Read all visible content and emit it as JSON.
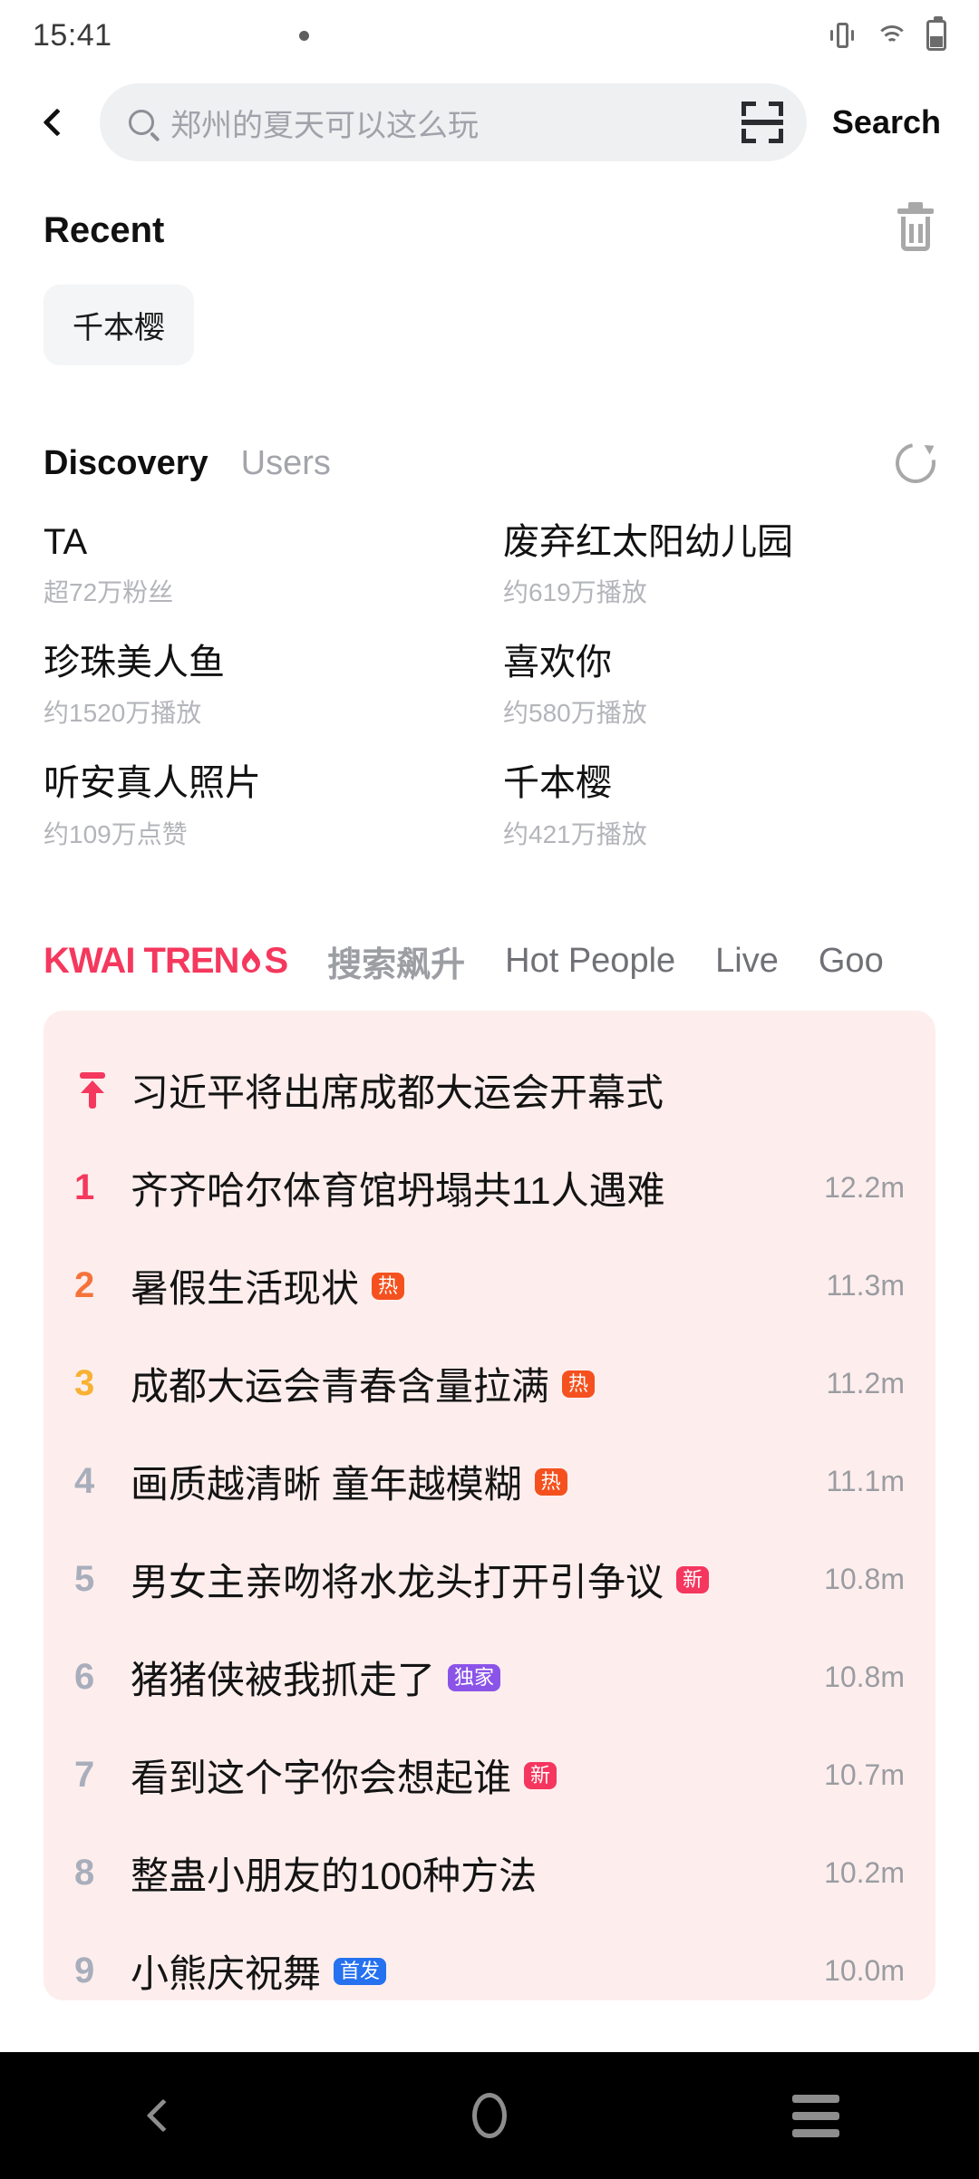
{
  "status_bar": {
    "time": "15:41",
    "left_icons": [
      "speedometer-icon",
      "bag-icon",
      "bag-icon",
      "bag-icon",
      "dot-icon"
    ],
    "right_icons": [
      "vibrate-icon",
      "wifi-icon",
      "battery-icon"
    ]
  },
  "header": {
    "back_icon": "chevron-left-icon",
    "search_placeholder": "郑州的夏天可以这么玩",
    "search_value": "",
    "scan_icon": "scan-icon",
    "search_button_label": "Search"
  },
  "recent": {
    "title": "Recent",
    "clear_icon": "trash-icon",
    "chips": [
      "千本樱"
    ]
  },
  "discovery": {
    "tabs": [
      {
        "label": "Discovery",
        "active": true
      },
      {
        "label": "Users",
        "active": false
      }
    ],
    "refresh_icon": "refresh-icon",
    "items": [
      {
        "title": "TA",
        "subtitle": "超72万粉丝"
      },
      {
        "title": "废弃红太阳幼儿园",
        "subtitle": "约619万播放"
      },
      {
        "title": "珍珠美人鱼",
        "subtitle": "约1520万播放"
      },
      {
        "title": "喜欢你",
        "subtitle": "约580万播放"
      },
      {
        "title": "听安真人照片",
        "subtitle": "约109万点赞"
      },
      {
        "title": "千本樱",
        "subtitle": "约421万播放"
      }
    ]
  },
  "trend_tabs": {
    "logo_prefix": "KWAI TREN",
    "logo_suffix": "S",
    "logo_color": "#f5385d",
    "items": [
      {
        "label": "搜索飙升",
        "cn": true
      },
      {
        "label": "Hot People",
        "cn": false
      },
      {
        "label": "Live",
        "cn": false
      },
      {
        "label": "Goo",
        "cn": false
      }
    ]
  },
  "trend_list": {
    "card_bg": "#fdeeed",
    "rank_colors": [
      "#f5385d",
      "#f5733a",
      "#f8b133",
      "#a8aebb"
    ],
    "rows": [
      {
        "rank": "",
        "pinned": true,
        "title": "习近平将出席成都大运会开幕式",
        "badge": "",
        "badge_color": "",
        "count": ""
      },
      {
        "rank": "1",
        "pinned": false,
        "title": "齐齐哈尔体育馆坍塌共11人遇难",
        "badge": "",
        "badge_color": "",
        "count": "12.2m"
      },
      {
        "rank": "2",
        "pinned": false,
        "title": "暑假生活现状",
        "badge": "热",
        "badge_color": "#f5511e",
        "count": "11.3m"
      },
      {
        "rank": "3",
        "pinned": false,
        "title": "成都大运会青春含量拉满",
        "badge": "热",
        "badge_color": "#f5511e",
        "count": "11.2m"
      },
      {
        "rank": "4",
        "pinned": false,
        "title": "画质越清晰 童年越模糊",
        "badge": "热",
        "badge_color": "#f5511e",
        "count": "11.1m"
      },
      {
        "rank": "5",
        "pinned": false,
        "title": "男女主亲吻将水龙头打开引争议",
        "badge": "新",
        "badge_color": "#f5365e",
        "count": "10.8m"
      },
      {
        "rank": "6",
        "pinned": false,
        "title": "猪猪侠被我抓走了",
        "badge": "独家",
        "badge_color": "#8b54e8",
        "count": "10.8m"
      },
      {
        "rank": "7",
        "pinned": false,
        "title": "看到这个字你会想起谁",
        "badge": "新",
        "badge_color": "#f5365e",
        "count": "10.7m"
      },
      {
        "rank": "8",
        "pinned": false,
        "title": "整蛊小朋友的100种方法",
        "badge": "",
        "badge_color": "",
        "count": "10.2m"
      },
      {
        "rank": "9",
        "pinned": false,
        "title": "小熊庆祝舞",
        "badge": "首发",
        "badge_color": "#2571f0",
        "count": "10.0m"
      }
    ]
  },
  "navbar": {
    "back_icon": "nav-back-icon",
    "home_icon": "nav-home-icon",
    "recents_icon": "nav-recents-icon"
  }
}
